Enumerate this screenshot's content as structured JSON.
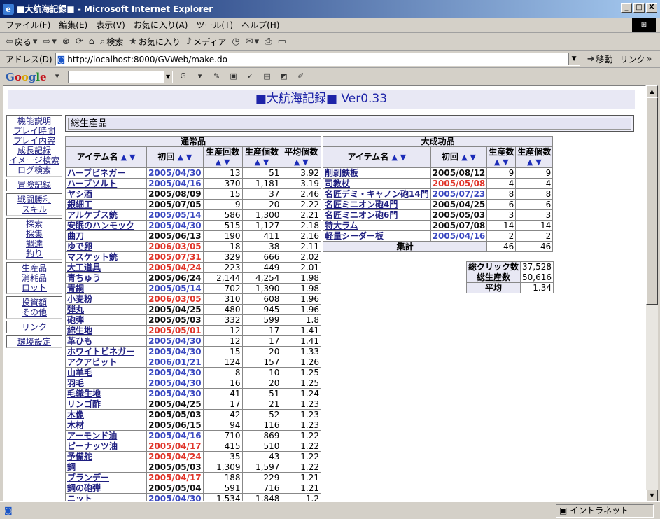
{
  "window": {
    "title": "■大航海記録■ - Microsoft Internet Explorer",
    "controls": [
      "_",
      "□",
      "X"
    ]
  },
  "menu": [
    "ファイル(F)",
    "編集(E)",
    "表示(V)",
    "お気に入り(A)",
    "ツール(T)",
    "ヘルプ(H)"
  ],
  "toolbar": {
    "back": "戻る",
    "search": "検索",
    "favorites": "お気に入り",
    "media": "メディア"
  },
  "address": {
    "label": "アドレス(D)",
    "url": "http://localhost:8000/GVWeb/make.do",
    "go": "移動",
    "links": "リンク"
  },
  "google": {
    "logo": "Google"
  },
  "page": {
    "title": "■大航海記録■  Ver0.33",
    "section": "総生産品"
  },
  "sidebar": [
    [
      "機能説明",
      "プレイ時間",
      "プレイ内容",
      "成長記録",
      "イメージ検索",
      "ログ検索"
    ],
    [
      "冒険記録"
    ],
    [
      "戦闘勝利",
      "スキル"
    ],
    [
      "探索",
      "採集",
      "調達",
      "釣り"
    ],
    [
      "生産品",
      "消耗品",
      "ロット"
    ],
    [
      "投資額",
      "その他"
    ],
    [
      "リンク"
    ],
    [
      "環境設定"
    ]
  ],
  "normal": {
    "caption": "通常品",
    "headers": {
      "name": "アイテム名",
      "date": "初回",
      "count": "生産回数",
      "qty": "生産個数",
      "avg": "平均個数"
    },
    "arrows": "▲ ▼",
    "rows": [
      [
        "ハーブビネガー",
        "2005/04/30",
        "blue",
        "13",
        "51",
        "3.92"
      ],
      [
        "ハーブソルト",
        "2005/04/16",
        "blue",
        "370",
        "1,181",
        "3.19"
      ],
      [
        "ヤシ酒",
        "2005/08/09",
        "black",
        "15",
        "37",
        "2.46"
      ],
      [
        "銀細工",
        "2005/07/05",
        "black",
        "9",
        "20",
        "2.22"
      ],
      [
        "アルケブス銃",
        "2005/05/14",
        "blue",
        "586",
        "1,300",
        "2.21"
      ],
      [
        "安眠のハンモック",
        "2005/04/30",
        "blue",
        "515",
        "1,127",
        "2.18"
      ],
      [
        "曲刀",
        "2005/06/13",
        "black",
        "190",
        "411",
        "2.16"
      ],
      [
        "ゆで卵",
        "2006/03/05",
        "red",
        "18",
        "38",
        "2.11"
      ],
      [
        "マスケット銃",
        "2005/07/31",
        "red",
        "329",
        "666",
        "2.02"
      ],
      [
        "大工道具",
        "2005/04/24",
        "red",
        "223",
        "449",
        "2.01"
      ],
      [
        "青ちゅう",
        "2005/06/24",
        "black",
        "2,144",
        "4,254",
        "1.98"
      ],
      [
        "青銅",
        "2005/05/14",
        "blue",
        "702",
        "1,390",
        "1.98"
      ],
      [
        "小麦粉",
        "2006/03/05",
        "red",
        "310",
        "608",
        "1.96"
      ],
      [
        "弾丸",
        "2005/04/25",
        "black",
        "480",
        "945",
        "1.96"
      ],
      [
        "砲弾",
        "2005/05/03",
        "black",
        "332",
        "599",
        "1.8"
      ],
      [
        "綿生地",
        "2005/05/01",
        "red",
        "12",
        "17",
        "1.41"
      ],
      [
        "革ひも",
        "2005/04/30",
        "blue",
        "12",
        "17",
        "1.41"
      ],
      [
        "ホワイトビネガー",
        "2005/04/30",
        "blue",
        "15",
        "20",
        "1.33"
      ],
      [
        "アクアビット",
        "2006/01/21",
        "blue",
        "124",
        "157",
        "1.26"
      ],
      [
        "山羊毛",
        "2005/04/30",
        "blue",
        "8",
        "10",
        "1.25"
      ],
      [
        "羽毛",
        "2005/04/30",
        "blue",
        "16",
        "20",
        "1.25"
      ],
      [
        "毛織生地",
        "2005/04/30",
        "blue",
        "41",
        "51",
        "1.24"
      ],
      [
        "リンゴ酢",
        "2005/04/25",
        "black",
        "17",
        "21",
        "1.23"
      ],
      [
        "木像",
        "2005/05/03",
        "black",
        "42",
        "52",
        "1.23"
      ],
      [
        "木材",
        "2005/06/15",
        "black",
        "94",
        "116",
        "1.23"
      ],
      [
        "アーモンド油",
        "2005/04/16",
        "blue",
        "710",
        "869",
        "1.22"
      ],
      [
        "ピーナッツ油",
        "2005/04/17",
        "red",
        "415",
        "510",
        "1.22"
      ],
      [
        "予備舵",
        "2005/04/24",
        "red",
        "35",
        "43",
        "1.22"
      ],
      [
        "鋼",
        "2005/05/03",
        "black",
        "1,309",
        "1,597",
        "1.22"
      ],
      [
        "ブランデー",
        "2005/04/17",
        "red",
        "188",
        "229",
        "1.21"
      ],
      [
        "鋼の砲弾",
        "2005/05/04",
        "black",
        "591",
        "716",
        "1.21"
      ],
      [
        "ニット",
        "2005/04/30",
        "blue",
        "1,534",
        "1,848",
        "1.2"
      ]
    ]
  },
  "great": {
    "caption": "大成功品",
    "headers": {
      "name": "アイテム名",
      "date": "初回",
      "count": "生産数",
      "qty": "生産個数"
    },
    "rows": [
      [
        "削剥鉄板",
        "2005/08/12",
        "black",
        "9",
        "9"
      ],
      [
        "司教杖",
        "2005/05/08",
        "red",
        "4",
        "4"
      ],
      [
        "名匠デミ・キャノン砲14門",
        "2005/07/23",
        "blue",
        "8",
        "8"
      ],
      [
        "名匠ミニオン砲4門",
        "2005/04/25",
        "black",
        "6",
        "6"
      ],
      [
        "名匠ミニオン砲6門",
        "2005/05/03",
        "black",
        "3",
        "3"
      ],
      [
        "特大ラム",
        "2005/07/08",
        "black",
        "14",
        "14"
      ],
      [
        "軽量シーダー板",
        "2005/04/16",
        "blue",
        "2",
        "2"
      ]
    ],
    "total_label": "集計",
    "total_count": "46",
    "total_qty": "46"
  },
  "stats": [
    [
      "総クリック数",
      "37,528"
    ],
    [
      "総生産数",
      "50,616"
    ],
    [
      "平均",
      "1.34"
    ]
  ],
  "status": {
    "zone": "イントラネット"
  }
}
